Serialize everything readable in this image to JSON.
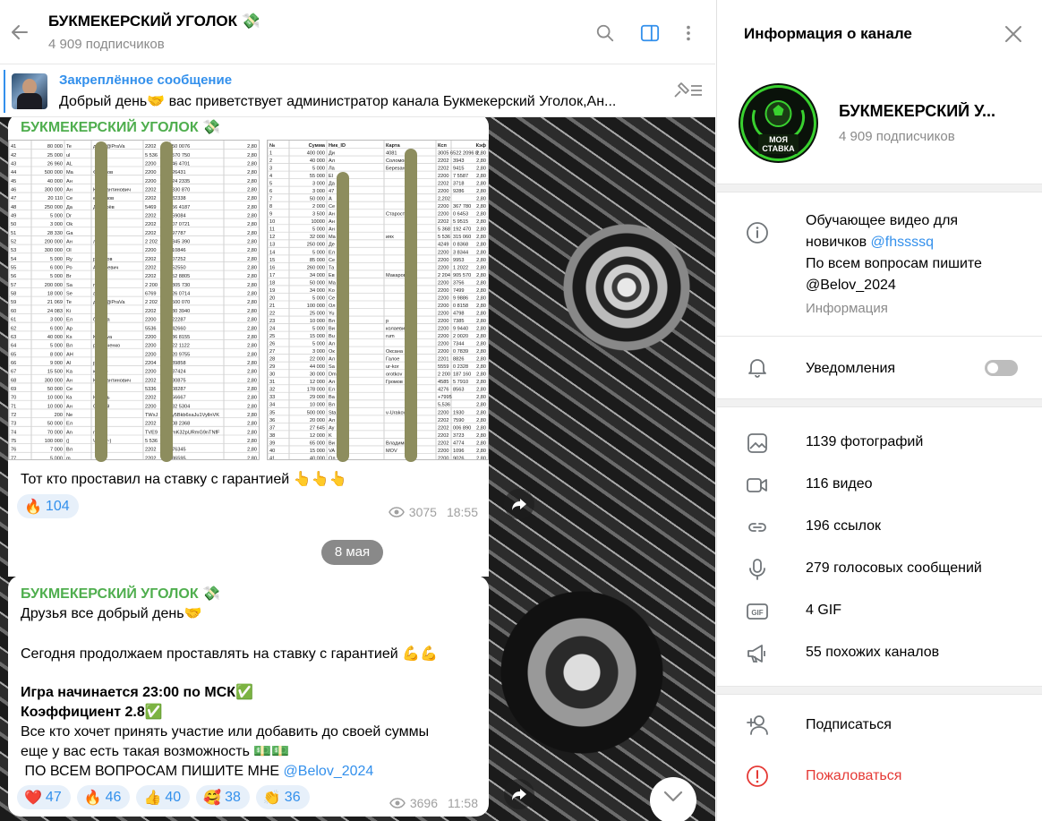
{
  "header": {
    "title": "БУКМЕКЕРСКИЙ УГОЛОК 💸",
    "subscribers": "4 909 подписчиков"
  },
  "pinned": {
    "label": "Закреплённое сообщение",
    "text": "Добрый день🤝 вас приветствует администратор канала Букмекерский Уголок,Ан..."
  },
  "messages": [
    {
      "sender": "БУКМЕКЕРСКИЙ УГОЛОК 💸",
      "caption": "Тот кто проставил на ставку с гарантией 👆👆👆",
      "reactions": [
        {
          "emoji": "🔥",
          "count": "104"
        }
      ],
      "views": "3075",
      "time": "18:55",
      "sheet_left": {
        "rows": [
          [
            "41",
            "80 000",
            "Te",
            "дезса@PraVa",
            "2202",
            "50 0076",
            "2,80"
          ],
          [
            "42",
            "25 000",
            "ul",
            "",
            "5 536",
            "570 750",
            "2,80"
          ],
          [
            "43",
            "26 960",
            "AL",
            "",
            "2200",
            "46 4701",
            "2,80"
          ],
          [
            "44",
            "500 000",
            "Ma",
            "Федотов",
            "2200",
            "26431",
            "2,80"
          ],
          [
            "45",
            "40 000",
            "Ан",
            "",
            "2200",
            "24 2335",
            "2,80"
          ],
          [
            "46",
            "300 000",
            "Ан",
            "Константинович",
            "2202",
            "830 870",
            "2,80"
          ],
          [
            "47",
            "20 110",
            "Се",
            "ерфонов",
            "2202",
            "32338",
            "2,80"
          ],
          [
            "48",
            "250 000",
            "Да",
            "Дегтярёв",
            "5469",
            "56 4187",
            "2,80"
          ],
          [
            "49",
            "5 000",
            "Dr",
            "",
            "2202",
            "59084",
            "2,80"
          ],
          [
            "50",
            "3 000",
            "Ok",
            "",
            "2202",
            "07 0721",
            "2,80"
          ],
          [
            "51",
            "28 330",
            "Ga",
            "",
            "2202",
            "97787",
            "2,80"
          ],
          [
            "52",
            "200 000",
            "Ан",
            "лот",
            "2 202",
            "845 390",
            "2,80"
          ],
          [
            "53",
            "300 000",
            "Ol",
            "",
            "2200",
            "10846",
            "2,80"
          ],
          [
            "54",
            "5 000",
            "Ry",
            "ралунов",
            "2202",
            "07252",
            "2,80"
          ],
          [
            "55",
            "6 000",
            "Ро",
            "Андреевич",
            "2202",
            "52550",
            "2,80"
          ],
          [
            "56",
            "5 000",
            "Br",
            "",
            "2202",
            "52 8805",
            "2,80"
          ],
          [
            "57",
            "200 000",
            "Sa",
            "mfort",
            "2 200",
            "305 730",
            "2,80"
          ],
          [
            "58",
            "18 000",
            "Se",
            "ankov",
            "6769",
            "26 0714",
            "2,80"
          ],
          [
            "59",
            "21 069",
            "Te",
            "дезса@PraVa",
            "2 202",
            "500 070",
            "2,80"
          ],
          [
            "60",
            "24 083",
            "Ki",
            "",
            "2202",
            "30 3940",
            "2,80"
          ],
          [
            "61",
            "3 000",
            "Ел",
            "бреева",
            "2200",
            "22287",
            "2,80"
          ],
          [
            "62",
            "6 000",
            "Ар",
            "",
            "5536",
            "42660",
            "2,80"
          ],
          [
            "63",
            "40 000",
            "Ks",
            "Kiseleva",
            "2200",
            "36 8155",
            "2,80"
          ],
          [
            "64",
            "5 000",
            "Вл",
            "р Демченко",
            "2200",
            "22 1122",
            "2,80"
          ],
          [
            "65",
            "8 000",
            "AH",
            "",
            "2200",
            "20 9755",
            "2,80"
          ],
          [
            "66",
            "9 000",
            "Al",
            "р",
            "2204",
            "89858",
            "2,80"
          ],
          [
            "67",
            "15 500",
            "Ka",
            "юша☺",
            "2200",
            "37424",
            "2,80"
          ],
          [
            "68",
            "300 000",
            "Ан",
            "Константинович",
            "2202",
            "30875",
            "2,80"
          ],
          [
            "69",
            "50 000",
            "Се",
            "",
            "5336",
            "08287",
            "2,80"
          ],
          [
            "70",
            "10 000",
            "Ка",
            "Юмень",
            "2202",
            "56667",
            "2,80"
          ],
          [
            "71",
            "10 000",
            "Ан",
            "Сергей",
            "2200",
            "32 5304",
            "2,80"
          ],
          [
            "72",
            "200",
            "Ne",
            "",
            "TWxJ",
            "y5Bkb6xaJu1VyllnVK",
            "2,80"
          ],
          [
            "73",
            "50 000",
            "Ел",
            "",
            "2202",
            "08 2368",
            "2,80"
          ],
          [
            "74",
            "70 000",
            "An",
            "rinov",
            "TVE9",
            "mK32pURmG9nTNfF",
            "2,80"
          ],
          [
            "75",
            "100 000",
            "(|",
            "\\(Al)(8~)",
            "5 536",
            "",
            "2,80"
          ],
          [
            "76",
            "7 000",
            "Вл",
            "",
            "2202",
            "76345",
            "2,80"
          ],
          [
            "77",
            "5 000",
            "m",
            "",
            "2202",
            "86595",
            "2,80"
          ]
        ]
      },
      "sheet_right": {
        "header": [
          "№",
          "Сумма",
          "Ник_ID",
          "Карта",
          "Ксп",
          "Кэф"
        ],
        "rows": [
          [
            "1",
            "400 000",
            "Ди",
            "4081",
            "3005 6522 2096 8",
            "2,80"
          ],
          [
            "2",
            "40 000",
            "Ал",
            "Соломонов",
            "2202",
            "3943",
            "2,80"
          ],
          [
            "3",
            "5 000",
            "Ла",
            "Березанова",
            "2202",
            "9415",
            "2,80"
          ],
          [
            "4",
            "55 000",
            "El",
            "",
            "2200",
            "7 5587",
            "2,80"
          ],
          [
            "5",
            "3 000",
            "Да",
            "",
            "2202",
            "3718",
            "2,80"
          ],
          [
            "6",
            "3 000",
            "47",
            "",
            "2200",
            "9286",
            "2,80"
          ],
          [
            "7",
            "50 000",
            "A",
            "",
            "2,202",
            "",
            "2,80"
          ],
          [
            "8",
            "2 000",
            "Се",
            "",
            "2200",
            "367 780",
            "2,80"
          ],
          [
            "9",
            "3 500",
            "Ан",
            "Старостенко",
            "2200",
            "0 6453",
            "2,80"
          ],
          [
            "10",
            "10000",
            "Ан",
            "",
            "2202",
            "5 9515",
            "2,80"
          ],
          [
            "11",
            "5 000",
            "Ан",
            "",
            "5 368",
            "192 470",
            "2,80"
          ],
          [
            "12",
            "32 000",
            "Ma",
            "иях",
            "5 536",
            "315 060",
            "2,80"
          ],
          [
            "13",
            "250 000",
            "Де",
            "",
            "4249",
            "0 8368",
            "2,80"
          ],
          [
            "14",
            "5 000",
            "Ел",
            "",
            "2200",
            "3 8344",
            "2,80"
          ],
          [
            "15",
            "85 000",
            "Се",
            "",
            "2200",
            "9953",
            "2,80"
          ],
          [
            "16",
            "260 000",
            "Та",
            "",
            "2200",
            "1 2022",
            "2,80"
          ],
          [
            "17",
            "34 000",
            "Ев",
            "Макаров",
            "2 204",
            "905 570",
            "2,80"
          ],
          [
            "18",
            "50 000",
            "Ма",
            "",
            "2200",
            "3756",
            "2,80"
          ],
          [
            "19",
            "34 000",
            "Ko",
            "",
            "2200",
            "7499",
            "2,80"
          ],
          [
            "20",
            "5 000",
            "Се",
            "",
            "2200",
            "9 9886",
            "2,80"
          ],
          [
            "21",
            "100 000",
            "Ол",
            "",
            "2200",
            "0 8158",
            "2,80"
          ],
          [
            "22",
            "25 000",
            "Yu",
            "",
            "2200",
            "4798",
            "2,80"
          ],
          [
            "23",
            "10 000",
            "Вл",
            "р",
            "2200",
            "7385",
            "2,80"
          ],
          [
            "24",
            "5 000",
            "Ви",
            "колаевич Во",
            "2200",
            "9 9440",
            "2,80"
          ],
          [
            "25",
            "15 000",
            "Bu",
            "rum",
            "2200",
            "2 0020",
            "2,80"
          ],
          [
            "26",
            "5 000",
            "Ал",
            "",
            "2200",
            "7344",
            "2,80"
          ],
          [
            "27",
            "3 000",
            "Ок",
            "Оксана",
            "2200",
            "0 7839",
            "2,80"
          ],
          [
            "28",
            "22 000",
            "Ал",
            "Галое",
            "2201",
            "8826",
            "2,80"
          ],
          [
            "29",
            "44 000",
            "Sa",
            "ur-kor",
            "5559",
            "0 2328",
            "2,80"
          ],
          [
            "30",
            "30 000",
            "Dm",
            "orotkov",
            "2 200",
            "187 160",
            "2,80"
          ],
          [
            "31",
            "12 000",
            "Ал",
            "Громов",
            "4585",
            "5 7910",
            "2,80"
          ],
          [
            "32",
            "178 000",
            "Ел",
            "",
            "4276",
            "8563",
            "2,80"
          ],
          [
            "33",
            "29 000",
            "Ва",
            "",
            "+7995",
            "",
            "2,80"
          ],
          [
            "34",
            "10 000",
            "Вл",
            "",
            "5,536",
            "",
            "2,80"
          ],
          [
            "35",
            "500 000",
            "Sta",
            "v-Urakov",
            "2200",
            "1930",
            "2,80"
          ],
          [
            "36",
            "20 000",
            "Ал",
            "",
            "2202",
            "7590",
            "2,80"
          ],
          [
            "37",
            "27 645",
            "Ay",
            "",
            "2202",
            "006 890",
            "2,80"
          ],
          [
            "38",
            "12 000",
            "K",
            "",
            "2202",
            "3723",
            "2,80"
          ],
          [
            "39",
            "65 000",
            "Ви",
            "Владимиров",
            "2202",
            "4774",
            "2,80"
          ],
          [
            "40",
            "15 000",
            "VA",
            "MOV",
            "2200",
            "1096",
            "2,80"
          ],
          [
            "41",
            "40 000",
            "Ол",
            "",
            "2200",
            "9026",
            "2,80"
          ]
        ]
      }
    },
    {
      "sender": "БУКМЕКЕРСКИЙ УГОЛОК 💸",
      "line1": "Друзья все добрый день🤝",
      "line2": "Сегодня продолжаем проставлять на ставку с гарантией 💪💪",
      "line3": "Игра начинается 23:00 по МСК✅",
      "line4": "Коэффициент 2.8✅",
      "line5": "Все кто хочет принять участие или добавить до своей суммы",
      "line6": "еще у вас есть такая возможность 💵💵",
      "line7": " ПО ВСЕМ ВОПРОСАМ ПИШИТЕ МНЕ ",
      "line7_link": "@Belov_2024",
      "reactions": [
        {
          "emoji": "❤️",
          "count": "47"
        },
        {
          "emoji": "🔥",
          "count": "46"
        },
        {
          "emoji": "👍",
          "count": "40"
        },
        {
          "emoji": "🥰",
          "count": "38"
        },
        {
          "emoji": "👏",
          "count": "36"
        }
      ],
      "views": "3696",
      "time": "11:58"
    }
  ],
  "date_separator": "8 мая",
  "panel": {
    "title": "Информация о канале",
    "channel_name": "БУКМЕКЕРСКИЙ У...",
    "subscribers": "4 909 подписчиков",
    "avatar_text_top": "МОЯ",
    "avatar_text_bottom": "СТАВКА",
    "info_line1": "Обучающее видео для",
    "info_line2_prefix": "новичков ",
    "info_line2_link": "@fhssssq",
    "info_line3": "По всем вопросам пишите",
    "info_line4_link": "@Belov_2024",
    "info_caption": "Информация",
    "notifications": "Уведомления",
    "notifications_on": false,
    "media": [
      {
        "icon": "photo-icon",
        "label": "1139 фотографий"
      },
      {
        "icon": "video-icon",
        "label": "116 видео"
      },
      {
        "icon": "link-icon",
        "label": "196 ссылок"
      },
      {
        "icon": "mic-icon",
        "label": "279 голосовых сообщений"
      },
      {
        "icon": "gif-icon",
        "label": "4 GIF"
      },
      {
        "icon": "megaphone-icon",
        "label": "55 похожих каналов"
      }
    ],
    "subscribe": "Подписаться",
    "report": "Пожаловаться"
  },
  "colors": {
    "accent": "#3390ec",
    "sender": "#4fae4e",
    "danger": "#e53935"
  }
}
